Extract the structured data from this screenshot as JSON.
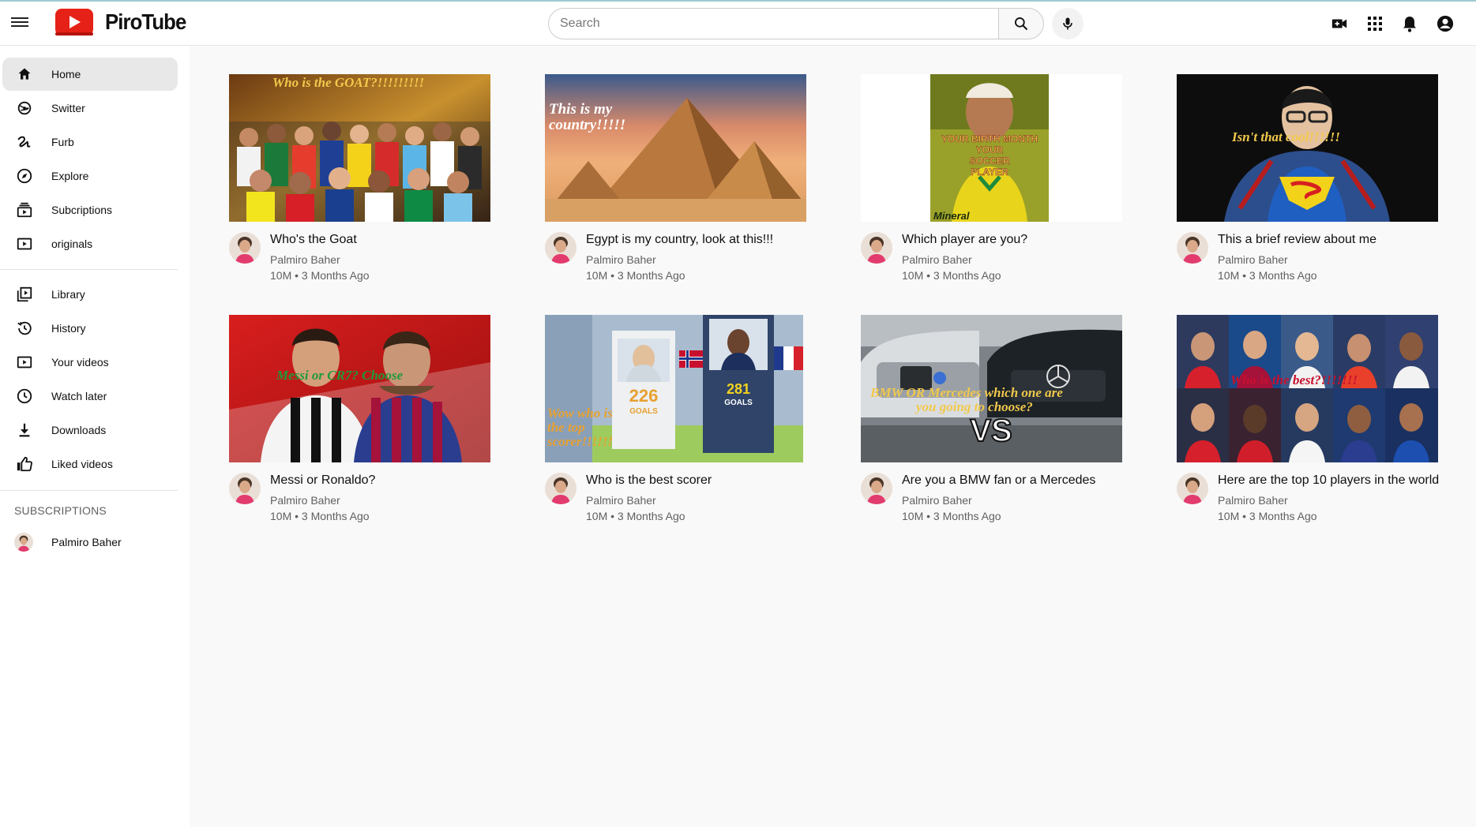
{
  "app": {
    "name": "PiroTube"
  },
  "search": {
    "placeholder": "Search"
  },
  "sidebar": {
    "main": [
      {
        "label": "Home",
        "icon": "home-icon"
      },
      {
        "label": "Switter",
        "icon": "switter-icon"
      },
      {
        "label": "Furb",
        "icon": "furb-icon"
      },
      {
        "label": "Explore",
        "icon": "explore-icon"
      },
      {
        "label": "Subcriptions",
        "icon": "subscriptions-icon"
      },
      {
        "label": "originals",
        "icon": "originals-icon"
      }
    ],
    "library": [
      {
        "label": "Library",
        "icon": "library-icon"
      },
      {
        "label": "History",
        "icon": "history-icon"
      },
      {
        "label": "Your videos",
        "icon": "your-videos-icon"
      },
      {
        "label": "Watch later",
        "icon": "watch-later-icon"
      },
      {
        "label": "Downloads",
        "icon": "downloads-icon"
      },
      {
        "label": "Liked videos",
        "icon": "liked-videos-icon"
      }
    ],
    "subscriptions_title": "SUBSCRIPTIONS",
    "subscriptions": [
      {
        "label": "Palmiro Baher"
      }
    ]
  },
  "videos": [
    {
      "title": "Who's the Goat",
      "channel": "Palmiro Baher",
      "meta": "10M • 3 Months Ago",
      "thumb_text": "Who is the GOAT?!!!!!!!!!"
    },
    {
      "title": "Egypt is my country, look at this!!!",
      "channel": "Palmiro Baher",
      "meta": "10M • 3 Months Ago",
      "thumb_text": "This is my country!!!!!"
    },
    {
      "title": "Which player are you?",
      "channel": "Palmiro Baher",
      "meta": "10M • 3 Months Ago",
      "thumb_text": "YOUR BIRTH MONTH YOUR SOCCER PLAYER"
    },
    {
      "title": "This a brief review about me",
      "channel": "Palmiro Baher",
      "meta": "10M • 3 Months Ago",
      "thumb_text": "Isn't that cool!!!!!!"
    },
    {
      "title": "Messi or Ronaldo?",
      "channel": "Palmiro Baher",
      "meta": "10M • 3 Months Ago",
      "thumb_text": "Messi or CR7? Choose"
    },
    {
      "title": "Who is the best scorer",
      "channel": "Palmiro Baher",
      "meta": "10M • 3 Months Ago",
      "thumb_text": "Wow who is the top scorer!!!!!!"
    },
    {
      "title": "Are you a BMW fan or a Mercedes",
      "channel": "Palmiro Baher",
      "meta": "10M • 3 Months Ago",
      "thumb_text": "BMW OR Mercedes which one are you going to choose?"
    },
    {
      "title": "Here are the top 10 players in the world",
      "channel": "Palmiro Baher",
      "meta": "10M • 3 Months Ago",
      "thumb_text": "Who is the best?!!!!!!!"
    }
  ],
  "colors": {
    "brand_red": "#e62117",
    "accent_line": "#9ecbd1"
  }
}
